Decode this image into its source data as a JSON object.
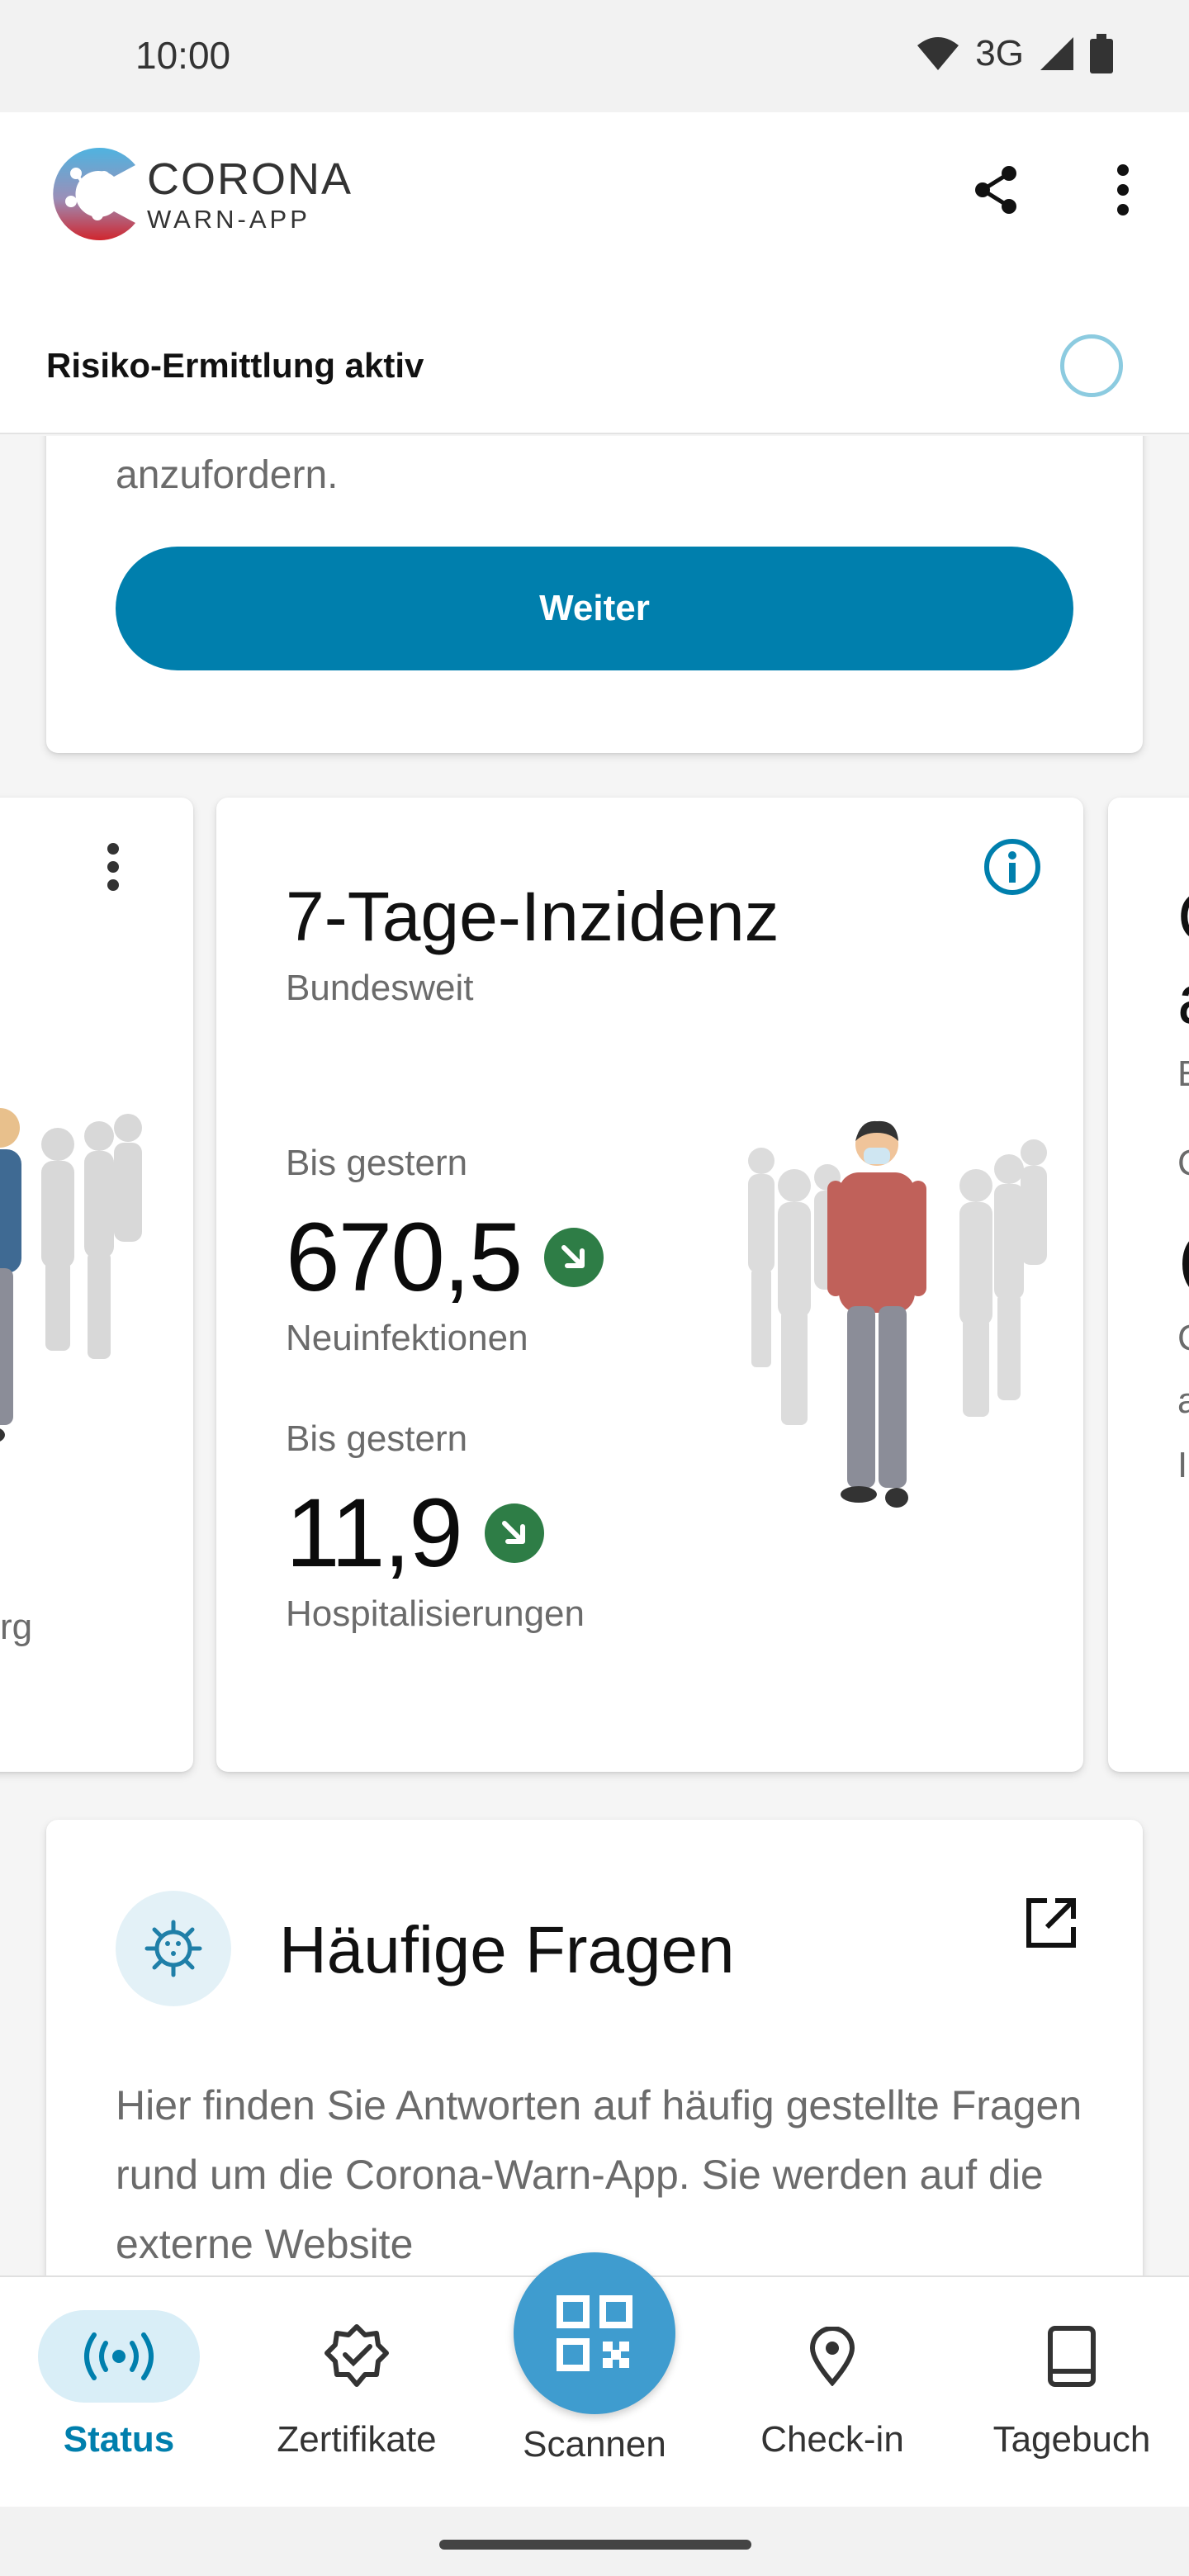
{
  "status_bar": {
    "time": "10:00",
    "network": "3G"
  },
  "header": {
    "logo_title": "CORONA",
    "logo_subtitle": "WARN-APP",
    "share_icon": "share-icon",
    "more_icon": "more-vert-icon"
  },
  "risk": {
    "label": "Risiko-Ermittlung aktiv"
  },
  "top_card": {
    "text": "anzufordern.",
    "button_label": "Weiter"
  },
  "stat_left": {
    "partial_text": "rg"
  },
  "incidence_card": {
    "title": "7-Tage-Inzidenz",
    "subtitle": "Bundesweit",
    "items": [
      {
        "label": "Bis gestern",
        "value": "670,5",
        "caption": "Neuinfektionen",
        "trend": "down"
      },
      {
        "label": "Bis gestern",
        "value": "11,9",
        "caption": "Hospitalisierungen",
        "trend": "down"
      }
    ]
  },
  "stat_right": {
    "partial_lines": [
      "C",
      "a",
      "E",
      "C",
      "C",
      "C",
      "a",
      "I"
    ]
  },
  "faq": {
    "title": "Häufige Fragen",
    "text": "Hier finden Sie Antworten auf häufig gestellte Fragen rund um die Corona-Warn-App. Sie werden auf die externe Website"
  },
  "bottom_nav": {
    "items": [
      {
        "label": "Status",
        "icon": "status-radio-icon",
        "active": true
      },
      {
        "label": "Zertifikate",
        "icon": "certificate-check-icon",
        "active": false
      },
      {
        "label": "Scannen",
        "icon": "qr-code-icon",
        "active": false
      },
      {
        "label": "Check-in",
        "icon": "location-pin-icon",
        "active": false
      },
      {
        "label": "Tagebuch",
        "icon": "book-icon",
        "active": false
      }
    ]
  },
  "colors": {
    "primary": "#007fad",
    "fab": "#3f9ccf",
    "trend_down": "#2e7d46",
    "active_nav_bg": "#d9eef7"
  }
}
